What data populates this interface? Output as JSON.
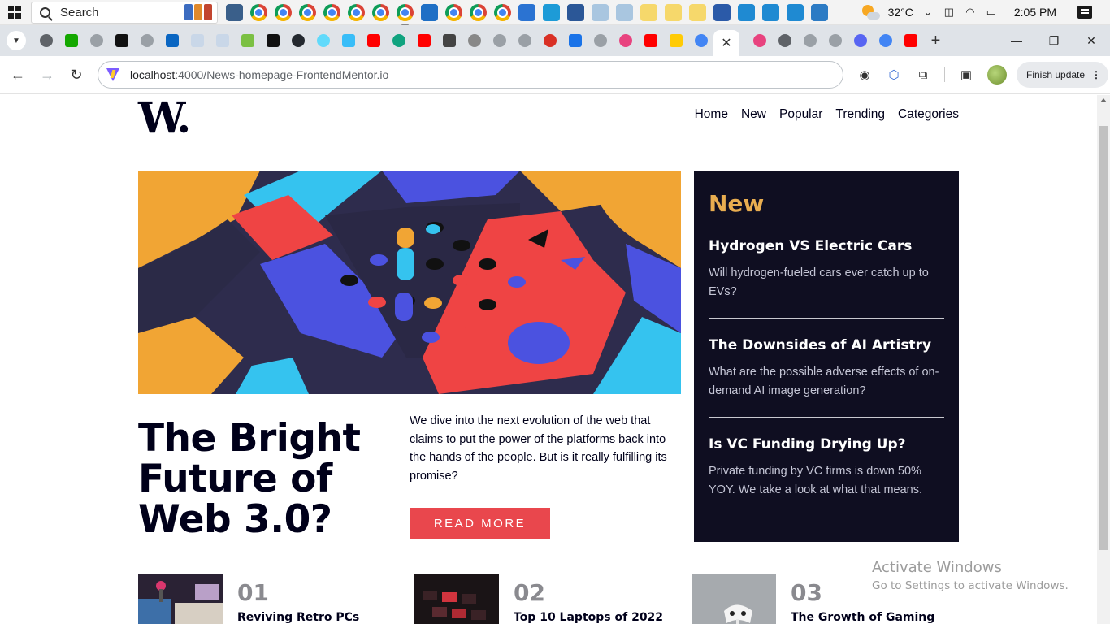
{
  "taskbar": {
    "search_placeholder": "Search",
    "temperature": "32°C",
    "time": "2:05 PM",
    "apps": [
      {
        "name": "widgets-icon",
        "color": "#3a5f8a"
      },
      {
        "name": "chrome-icon",
        "color": "chrome"
      },
      {
        "name": "chrome-icon",
        "color": "chrome"
      },
      {
        "name": "chrome-icon",
        "color": "chrome"
      },
      {
        "name": "chrome-icon",
        "color": "chrome"
      },
      {
        "name": "chrome-icon",
        "color": "chrome"
      },
      {
        "name": "chrome-icon",
        "color": "chrome"
      },
      {
        "name": "chrome-icon",
        "color": "chrome"
      },
      {
        "name": "store-icon",
        "color": "#1f6fc5"
      },
      {
        "name": "chrome-icon",
        "color": "chrome"
      },
      {
        "name": "chrome-icon",
        "color": "chrome"
      },
      {
        "name": "chrome-icon",
        "color": "chrome"
      },
      {
        "name": "mail-icon",
        "color": "#2b73d2"
      },
      {
        "name": "edge-icon",
        "color": "#1d9bd7"
      },
      {
        "name": "word-icon",
        "color": "#2b5797"
      },
      {
        "name": "notepad-icon",
        "color": "#a9c6e0"
      },
      {
        "name": "notepad-icon",
        "color": "#a9c6e0"
      },
      {
        "name": "sticky-notes-icon",
        "color": "#f6d86b"
      },
      {
        "name": "sticky-notes-icon",
        "color": "#f6d86b"
      },
      {
        "name": "sticky-notes-icon",
        "color": "#f6d86b"
      },
      {
        "name": "powershell-icon",
        "color": "#2b5aa8"
      },
      {
        "name": "vscode-icon",
        "color": "#1f8ad2"
      },
      {
        "name": "vscode-icon",
        "color": "#1f8ad2"
      },
      {
        "name": "vscode-icon",
        "color": "#1f8ad2"
      },
      {
        "name": "photos-icon",
        "color": "#2c7bc4"
      }
    ]
  },
  "browser": {
    "tab_favicons": [
      {
        "name": "chrome-favicon",
        "color": "#5f6368",
        "round": true
      },
      {
        "name": "upwork-favicon",
        "color": "#14a800",
        "round": false
      },
      {
        "name": "settings-favicon",
        "color": "#9aa0a6",
        "round": true
      },
      {
        "name": "codecademy-favicon",
        "color": "#111111",
        "round": false
      },
      {
        "name": "site-favicon",
        "color": "#9aa0a6",
        "round": true
      },
      {
        "name": "linkedin-favicon",
        "color": "#0a66c2",
        "round": false
      },
      {
        "name": "page-favicon",
        "color": "#c9d7e8",
        "round": false
      },
      {
        "name": "page-favicon",
        "color": "#c9d7e8",
        "round": false
      },
      {
        "name": "dev-favicon",
        "color": "#7bc043",
        "round": false
      },
      {
        "name": "medium-favicon",
        "color": "#111111",
        "round": false
      },
      {
        "name": "github-favicon",
        "color": "#24292f",
        "round": true
      },
      {
        "name": "react-favicon",
        "color": "#61dafb",
        "round": true
      },
      {
        "name": "tailwind-favicon",
        "color": "#38bdf8",
        "round": false
      },
      {
        "name": "youtube-favicon",
        "color": "#ff0000",
        "round": false
      },
      {
        "name": "chatgpt-favicon",
        "color": "#10a37f",
        "round": true
      },
      {
        "name": "youtube-favicon",
        "color": "#ff0000",
        "round": false
      },
      {
        "name": "wikipedia-favicon",
        "color": "#444444",
        "round": false
      },
      {
        "name": "wikipedia-favicon",
        "color": "#888888",
        "round": true
      },
      {
        "name": "site-favicon",
        "color": "#9aa0a6",
        "round": true
      },
      {
        "name": "site-favicon",
        "color": "#9aa0a6",
        "round": true
      },
      {
        "name": "badge-favicon",
        "color": "#d93025",
        "round": true
      },
      {
        "name": "play-favicon",
        "color": "#1a73e8",
        "round": false
      },
      {
        "name": "site-favicon",
        "color": "#9aa0a6",
        "round": true
      },
      {
        "name": "record-favicon",
        "color": "#e8437f",
        "round": true
      },
      {
        "name": "youtube-favicon",
        "color": "#ff0000",
        "round": false
      },
      {
        "name": "michigan-favicon",
        "color": "#ffcb05",
        "round": false
      },
      {
        "name": "google-favicon",
        "color": "#4285f4",
        "round": true
      }
    ],
    "tab_favicons_after": [
      {
        "name": "record-favicon",
        "color": "#e8437f",
        "round": true
      },
      {
        "name": "chrome-favicon",
        "color": "#5f6368",
        "round": true
      },
      {
        "name": "google-favicon",
        "color": "#9aa0a6",
        "round": true
      },
      {
        "name": "google-favicon",
        "color": "#9aa0a6",
        "round": true
      },
      {
        "name": "discord-favicon",
        "color": "#5865f2",
        "round": true
      },
      {
        "name": "shield-favicon",
        "color": "#4285f4",
        "round": true
      },
      {
        "name": "youtube-favicon",
        "color": "#ff0000",
        "round": false
      }
    ],
    "url_host": "localhost",
    "url_path": ":4000/News-homepage-FrontendMentor.io",
    "finish_update": "Finish update"
  },
  "site": {
    "logo": "W.",
    "nav": [
      "Home",
      "New",
      "Popular",
      "Trending",
      "Categories"
    ],
    "hero": {
      "title": "The Bright Future of Web 3.0?",
      "description": "We dive into the next evolution of the web that claims to put the power of the platforms back into the hands of the people. But is it really fulfilling its promise?",
      "cta": "READ MORE"
    },
    "new_panel": {
      "heading": "New",
      "items": [
        {
          "title": "Hydrogen VS Electric Cars",
          "desc": "Will hydrogen-fueled cars ever catch up to EVs?"
        },
        {
          "title": "The Downsides of AI Artistry",
          "desc": "What are the possible adverse effects of on-demand AI image generation?"
        },
        {
          "title": "Is VC Funding Drying Up?",
          "desc": "Private funding by VC firms is down 50% YOY. We take a look at what that means."
        }
      ]
    },
    "cards": [
      {
        "num": "01",
        "title": "Reviving Retro PCs"
      },
      {
        "num": "02",
        "title": "Top 10 Laptops of 2022"
      },
      {
        "num": "03",
        "title": "The Growth of Gaming"
      }
    ]
  },
  "watermark": {
    "line1": "Activate Windows",
    "line2": "Go to Settings to activate Windows."
  }
}
